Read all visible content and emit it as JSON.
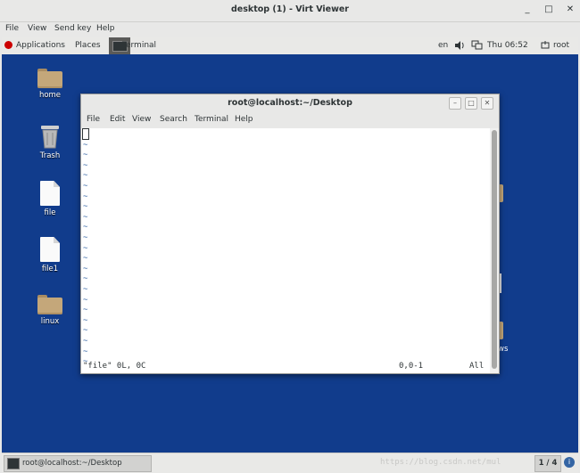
{
  "viewer": {
    "title": "desktop (1) - Virt Viewer",
    "controls": {
      "minimize": "_",
      "maximize": "□",
      "close": "✕"
    },
    "menu": [
      "File",
      "View",
      "Send key",
      "Help"
    ]
  },
  "guest_panel": {
    "applications": "Applications",
    "places": "Places",
    "terminal_tab": "Terminal",
    "lang": "en",
    "clock": "Thu 06:52",
    "user": "root"
  },
  "desktop": {
    "icons": [
      {
        "label": "home",
        "type": "folder-home"
      },
      {
        "label": "Trash",
        "type": "trash"
      },
      {
        "label": "file",
        "type": "document"
      },
      {
        "label": "file1",
        "type": "document"
      },
      {
        "label": "linux",
        "type": "folder"
      }
    ],
    "partial_label_right": "ws"
  },
  "terminal": {
    "title": "root@localhost:~/Desktop",
    "menu": [
      "File",
      "Edit",
      "View",
      "Search",
      "Terminal",
      "Help"
    ],
    "tilde": "~",
    "status_left": "\"file\" 0L, 0C",
    "status_pos": "0,0-1",
    "status_right": "All"
  },
  "bottom_panel": {
    "task_label": "root@localhost:~/Desktop",
    "workspace": "1 / 4",
    "watermark": "https://blog.csdn.net/mul"
  },
  "colors": {
    "desktop": "#113c8c",
    "panel": "#e9e9e7",
    "vim_tilde": "#3465a4"
  }
}
